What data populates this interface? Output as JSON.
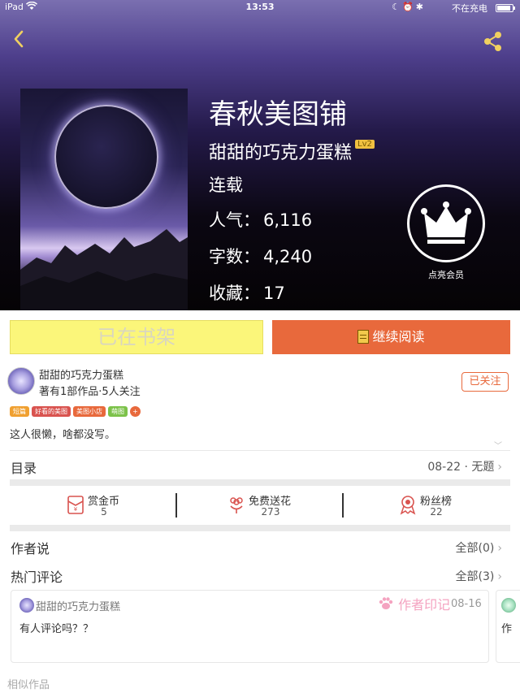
{
  "status_bar": {
    "device": "iPad",
    "time": "13:53",
    "charging": "不在充电",
    "battery_level": 0.9
  },
  "book": {
    "title": "春秋美图铺",
    "author": "甜甜的巧克力蛋糕",
    "level_badge": "Lv2",
    "status": "连载",
    "stats": [
      {
        "label": "人气：",
        "value": "6,116"
      },
      {
        "label": "字数：",
        "value": "4,240"
      },
      {
        "label": "收藏：",
        "value": "17"
      }
    ],
    "vip_label": "点亮会员"
  },
  "actions": {
    "shelf_label": "已在书架",
    "read_label": "继续阅读"
  },
  "author_panel": {
    "name": "甜甜的巧克力蛋糕",
    "meta": "著有1部作品·5人关注",
    "follow_label": "已关注",
    "tags": [
      {
        "label": "短篇",
        "color": "#f0a030"
      },
      {
        "label": "好看的美图",
        "color": "#d9534f"
      },
      {
        "label": "美图小店",
        "color": "#e8693c"
      },
      {
        "label": "萌图",
        "color": "#7cc24a"
      }
    ],
    "tag_more": "+",
    "tag_more_color": "#e8693c",
    "bio": "这人很懒，啥都没写。"
  },
  "catalog": {
    "title": "目录",
    "right": "08-22 · 无题"
  },
  "rewards": [
    {
      "name": "赏金币",
      "value": "5",
      "icon": "red-envelope-icon"
    },
    {
      "name": "免费送花",
      "value": "273",
      "icon": "flower-icon"
    },
    {
      "name": "粉丝榜",
      "value": "22",
      "icon": "medal-icon"
    }
  ],
  "author_says": {
    "title": "作者说",
    "right": "全部(0)"
  },
  "hot_comments": {
    "title": "热门评论",
    "right": "全部(3)",
    "items": [
      {
        "user": "甜甜的巧克力蛋糕",
        "badge": "作者印记",
        "date": "08-16",
        "text": "有人评论吗？？"
      }
    ],
    "peek_text": "作"
  },
  "similar": {
    "title": "相似作品"
  },
  "colors": {
    "accent": "#e8693c",
    "shelf_button": "#fbf67a",
    "badge_pink": "#f4a3c0"
  }
}
